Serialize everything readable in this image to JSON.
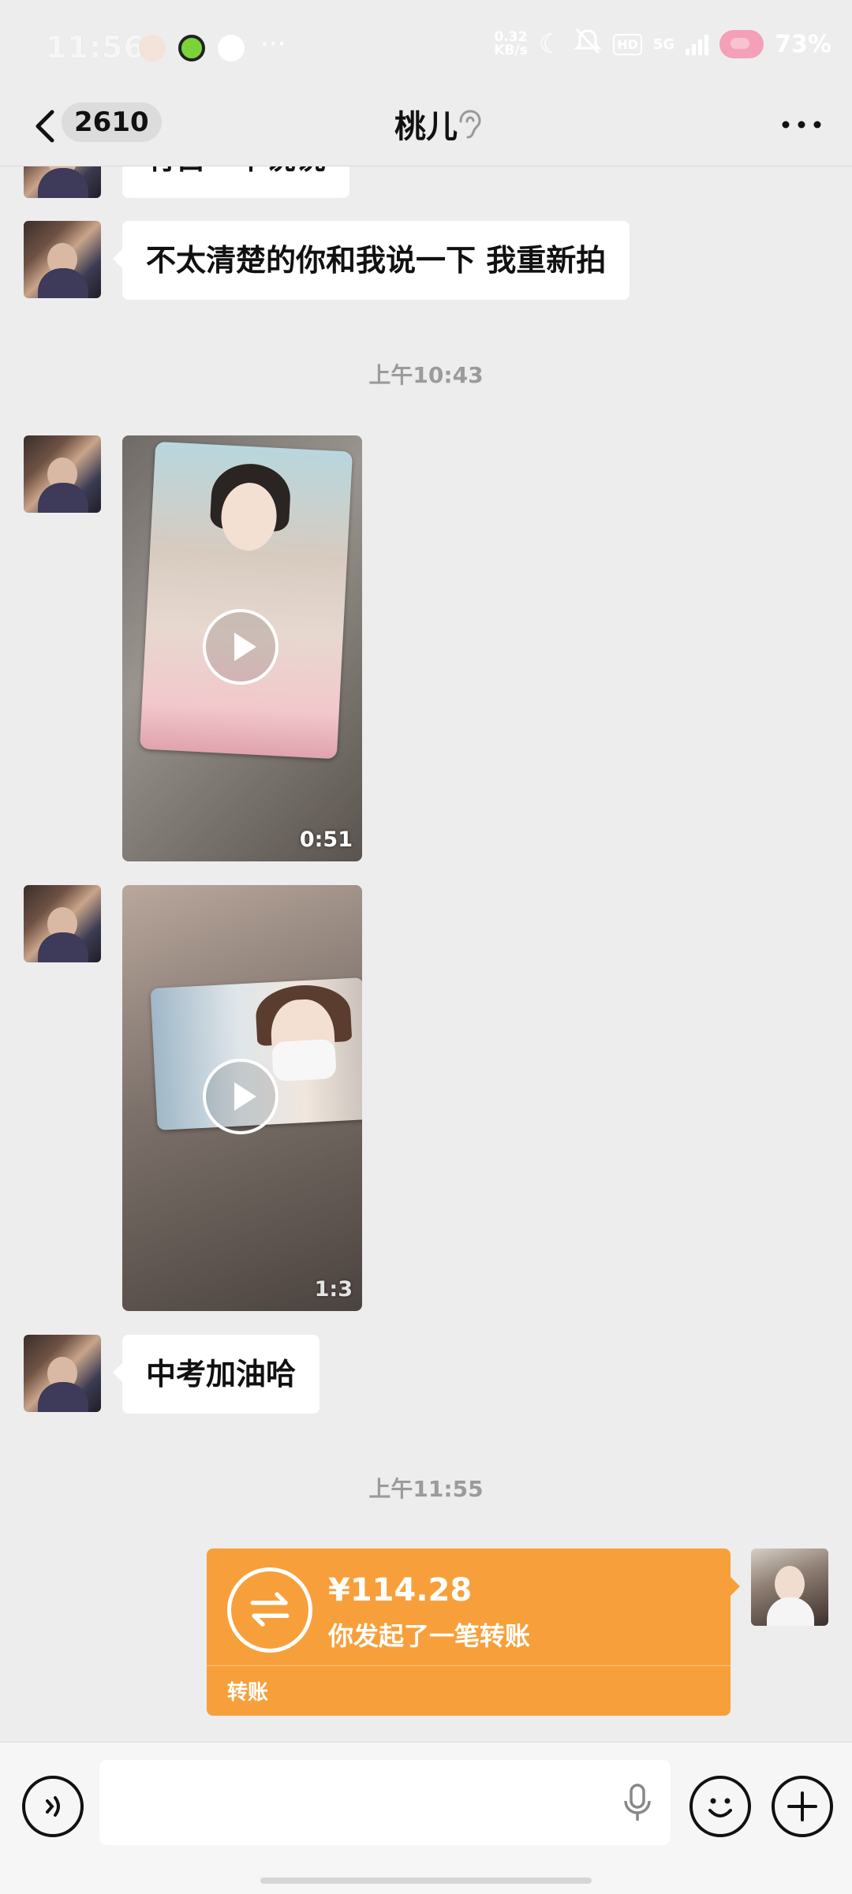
{
  "status_bar": {
    "time": "11:56",
    "more": "···",
    "net_speed_value": "0.32",
    "net_speed_unit": "KB/s",
    "hd": "HD",
    "network": "5G",
    "battery": "73%"
  },
  "header": {
    "back_count": "2610",
    "title": "桃儿",
    "icons": [
      "back-arrow-icon",
      "ear-icon",
      "more-icon"
    ]
  },
  "messages": {
    "partial_top": "有占一个说说",
    "msg1": "不太清楚的你和我说一下 我重新拍",
    "time1": "上午10:43",
    "video1_duration": "0:51",
    "video2_duration": "1:3",
    "msg2": "中考加油哈",
    "time2": "上午11:55"
  },
  "transfer": {
    "amount": "¥114.28",
    "description": "你发起了一笔转账",
    "label": "转账",
    "color": "#f7a03b"
  },
  "input_bar": {
    "icons": [
      "voice-icon",
      "mic-icon",
      "emoji-icon",
      "plus-icon"
    ]
  }
}
